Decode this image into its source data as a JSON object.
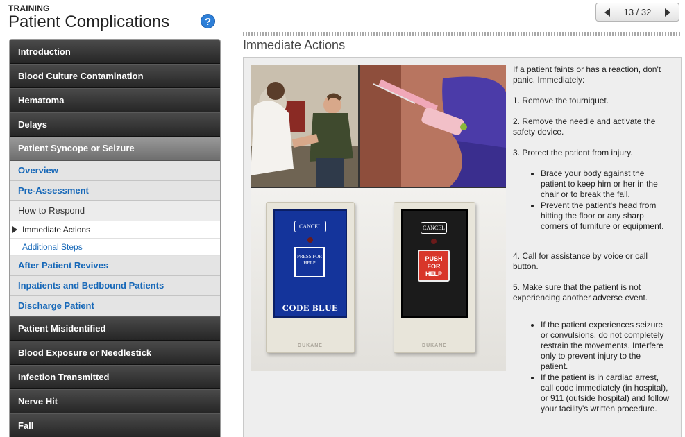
{
  "header": {
    "category": "TRAINING",
    "title": "Patient Complications",
    "help_label": "?"
  },
  "pager": {
    "text": "13 / 32"
  },
  "sidebar": {
    "items_top": [
      "Introduction",
      "Blood Culture Contamination",
      "Hematoma",
      "Delays"
    ],
    "active_section": "Patient Syncope or Seizure",
    "sub_items_a": [
      "Overview",
      "Pre-Assessment"
    ],
    "sub_plain": "How to Respond",
    "leaf_current": "Immediate Actions",
    "leaf_link": "Additional Steps",
    "sub_items_b": [
      "After Patient Revives",
      "Inpatients and Bedbound Patients",
      "Discharge Patient"
    ],
    "items_bottom": [
      "Patient Misidentified",
      "Blood Exposure or Needlestick",
      "Infection Transmitted",
      "Nerve Hit",
      "Fall"
    ]
  },
  "content": {
    "title": "Immediate Actions",
    "photo": {
      "cancel_label": "CANCEL",
      "press_label": "PRESS FOR HELP",
      "code_blue_label": "CODE BLUE",
      "push_label": "PUSH FOR HELP",
      "brand_label": "DUKANE"
    },
    "intro": "If a patient faints or has a reaction, don't panic. Immediately:",
    "step1": "1. Remove the tourniquet.",
    "step2": "2. Remove the needle and activate the safety device.",
    "step3": "3. Protect the patient from injury.",
    "step3_bullets": [
      "Brace your body against the patient to keep him or her in the chair or to break the fall.",
      "Prevent the patient's head from hitting the floor or any sharp corners of furniture or equipment."
    ],
    "step4": "4. Call for assistance by voice or call button.",
    "step5": "5. Make sure that the patient is not experiencing another adverse event.",
    "step5_bullets": [
      "If the patient experiences seizure or convulsions, do not completely restrain the movements. Interfere only to prevent injury to the patient.",
      "If the patient is in cardiac arrest, call code immediately (in hospital), or 911 (outside hospital) and follow your facility's written procedure."
    ]
  }
}
